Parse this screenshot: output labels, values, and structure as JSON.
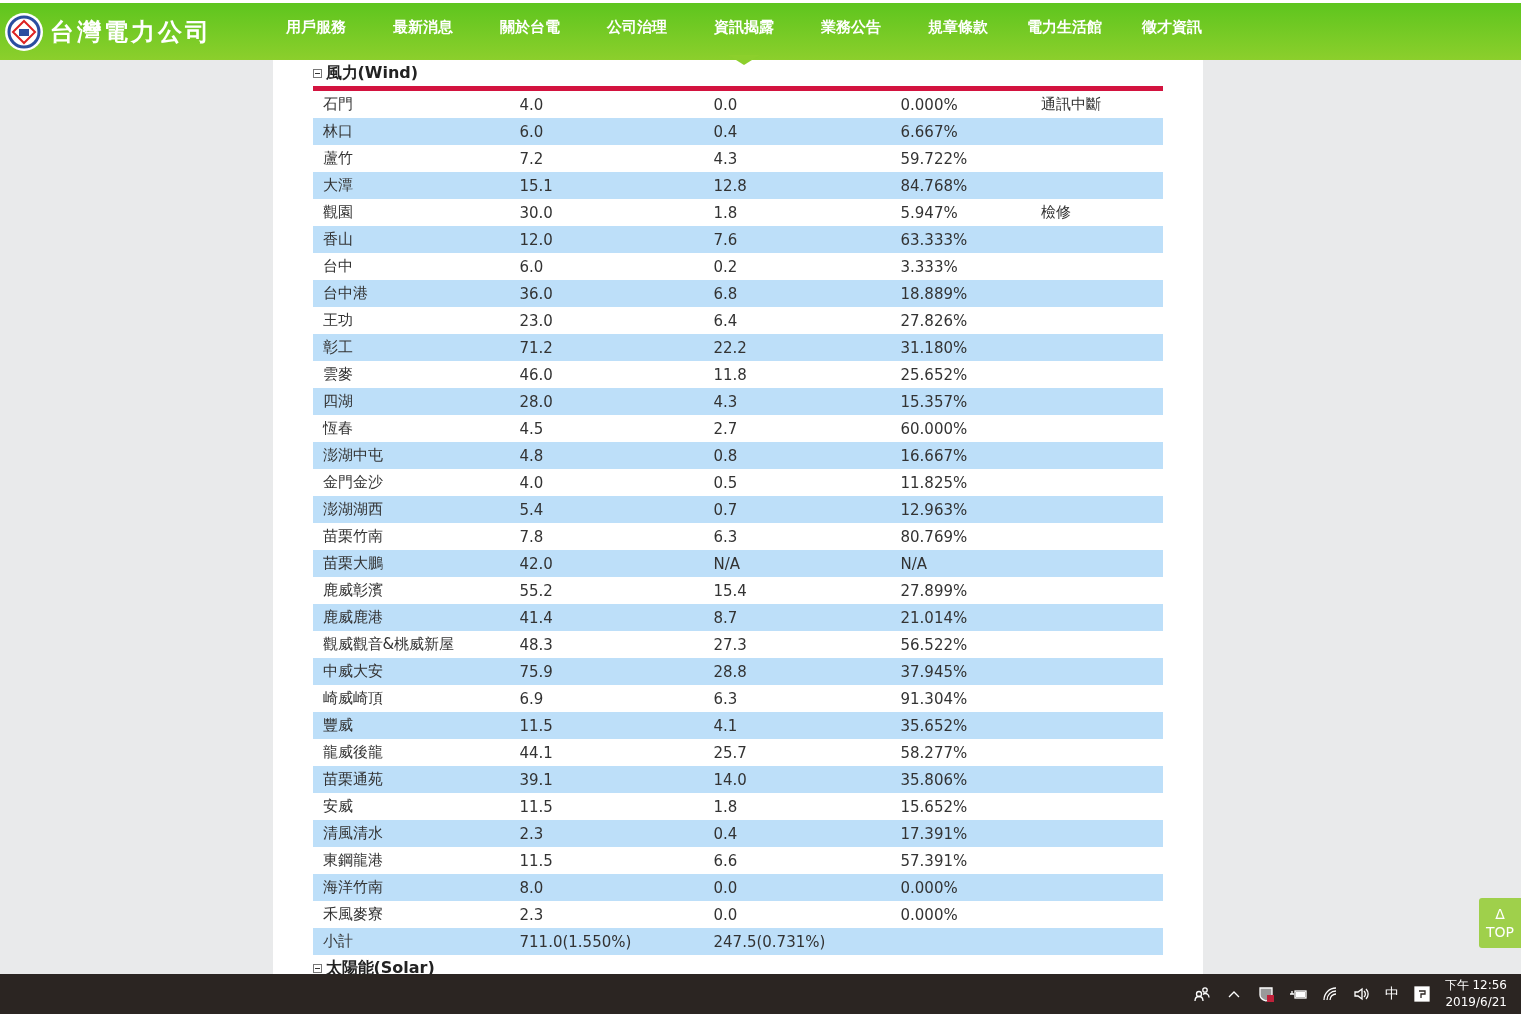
{
  "header": {
    "logo_text": "台灣電力公司",
    "nav": [
      {
        "label": "用戶服務",
        "selected": false
      },
      {
        "label": "最新消息",
        "selected": false
      },
      {
        "label": "關於台電",
        "selected": false
      },
      {
        "label": "公司治理",
        "selected": false
      },
      {
        "label": "資訊揭露",
        "selected": true
      },
      {
        "label": "業務公告",
        "selected": false
      },
      {
        "label": "規章條款",
        "selected": false
      },
      {
        "label": "電力生活館",
        "selected": false
      },
      {
        "label": "徵才資訊",
        "selected": false
      }
    ]
  },
  "sections": [
    {
      "title": "風力(Wind)",
      "expanded": true,
      "rows": [
        [
          "石門",
          "4.0",
          "0.0",
          "0.000%",
          "通訊中斷"
        ],
        [
          "林口",
          "6.0",
          "0.4",
          "6.667%",
          ""
        ],
        [
          "蘆竹",
          "7.2",
          "4.3",
          "59.722%",
          ""
        ],
        [
          "大潭",
          "15.1",
          "12.8",
          "84.768%",
          ""
        ],
        [
          "觀園",
          "30.0",
          "1.8",
          "5.947%",
          "檢修"
        ],
        [
          "香山",
          "12.0",
          "7.6",
          "63.333%",
          ""
        ],
        [
          "台中",
          "6.0",
          "0.2",
          "3.333%",
          ""
        ],
        [
          "台中港",
          "36.0",
          "6.8",
          "18.889%",
          ""
        ],
        [
          "王功",
          "23.0",
          "6.4",
          "27.826%",
          ""
        ],
        [
          "彰工",
          "71.2",
          "22.2",
          "31.180%",
          ""
        ],
        [
          "雲麥",
          "46.0",
          "11.8",
          "25.652%",
          ""
        ],
        [
          "四湖",
          "28.0",
          "4.3",
          "15.357%",
          ""
        ],
        [
          "恆春",
          "4.5",
          "2.7",
          "60.000%",
          ""
        ],
        [
          "澎湖中屯",
          "4.8",
          "0.8",
          "16.667%",
          ""
        ],
        [
          "金門金沙",
          "4.0",
          "0.5",
          "11.825%",
          ""
        ],
        [
          "澎湖湖西",
          "5.4",
          "0.7",
          "12.963%",
          ""
        ],
        [
          "苗栗竹南",
          "7.8",
          "6.3",
          "80.769%",
          ""
        ],
        [
          "苗栗大鵬",
          "42.0",
          "N/A",
          "N/A",
          ""
        ],
        [
          "鹿威彰濱",
          "55.2",
          "15.4",
          "27.899%",
          ""
        ],
        [
          "鹿威鹿港",
          "41.4",
          "8.7",
          "21.014%",
          ""
        ],
        [
          "觀威觀音&桃威新屋",
          "48.3",
          "27.3",
          "56.522%",
          ""
        ],
        [
          "中威大安",
          "75.9",
          "28.8",
          "37.945%",
          ""
        ],
        [
          "崎威崎頂",
          "6.9",
          "6.3",
          "91.304%",
          ""
        ],
        [
          "豐威",
          "11.5",
          "4.1",
          "35.652%",
          ""
        ],
        [
          "龍威後龍",
          "44.1",
          "25.7",
          "58.277%",
          ""
        ],
        [
          "苗栗通苑",
          "39.1",
          "14.0",
          "35.806%",
          ""
        ],
        [
          "安威",
          "11.5",
          "1.8",
          "15.652%",
          ""
        ],
        [
          "清風清水",
          "2.3",
          "0.4",
          "17.391%",
          ""
        ],
        [
          "東鋼龍港",
          "11.5",
          "6.6",
          "57.391%",
          ""
        ],
        [
          "海洋竹南",
          "8.0",
          "0.0",
          "0.000%",
          ""
        ],
        [
          "禾風麥寮",
          "2.3",
          "0.0",
          "0.000%",
          ""
        ],
        [
          "小計",
          "711.0(1.550%)",
          "247.5(0.731%)",
          "",
          ""
        ]
      ]
    },
    {
      "title": "太陽能(Solar)",
      "expanded": true
    }
  ],
  "top_button": {
    "arrow": "Δ",
    "label": "TOP"
  },
  "taskbar": {
    "ime": "中",
    "time": "下午 12:56",
    "date": "2019/6/21"
  }
}
